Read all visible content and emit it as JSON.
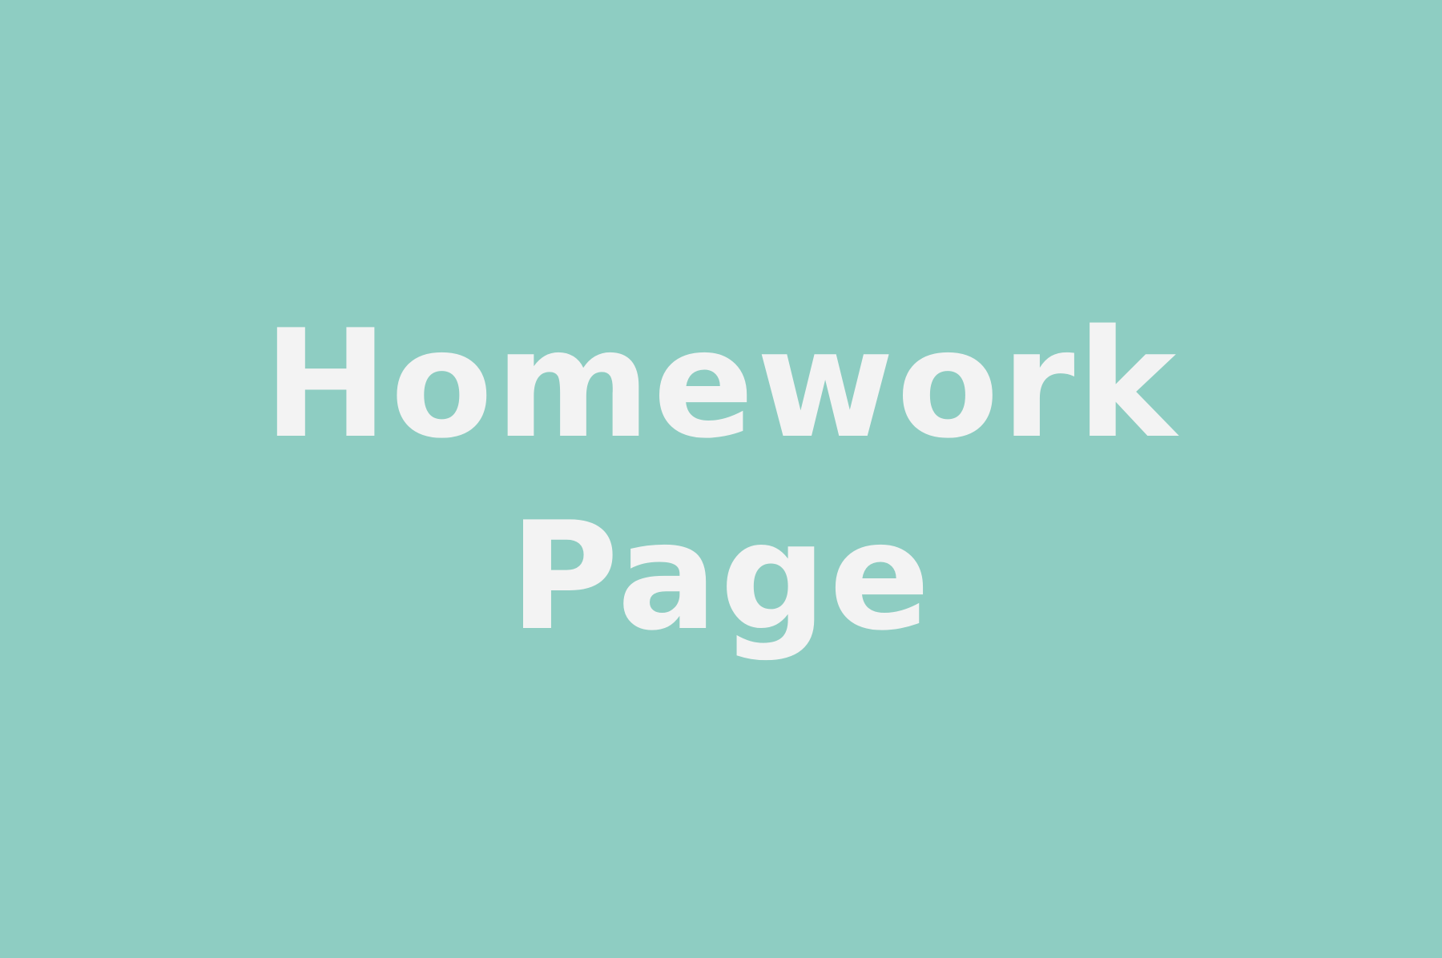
{
  "colors": {
    "background": "#8ecdc2",
    "text": "#f3f3f3"
  },
  "title": {
    "line1": "Homework",
    "line2": "Page"
  }
}
